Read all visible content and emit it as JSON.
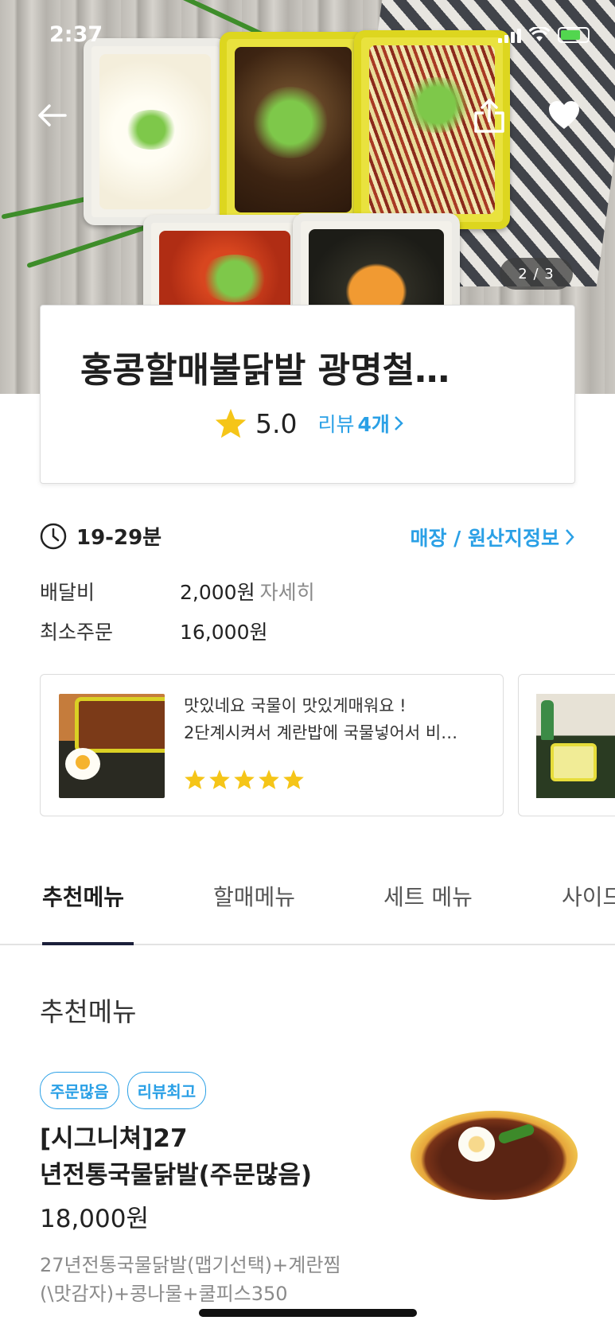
{
  "status_bar": {
    "time": "2:37"
  },
  "hero": {
    "image_counter": "2 / 3"
  },
  "store": {
    "name": "홍콩할매불닭발 광명철…",
    "rating": "5.0",
    "review_label": "리뷰",
    "review_count": "4개",
    "rating_stars": 5
  },
  "info": {
    "delivery_time": "19-29분",
    "origin_link": "매장 / 원산지정보",
    "delivery_fee_label": "배달비",
    "delivery_fee_value": "2,000원",
    "delivery_fee_detail": "자세히",
    "min_order_label": "최소주문",
    "min_order_value": "16,000원"
  },
  "reviews": [
    {
      "line1": "맛있네요 국물이 맛있게매워요 !",
      "line2": "2단계시켜서 계란밥에 국물넣어서 비…",
      "stars": 5
    }
  ],
  "tabs": [
    {
      "label": "추천메뉴",
      "active": true
    },
    {
      "label": "할매메뉴",
      "active": false
    },
    {
      "label": "세트 메뉴",
      "active": false
    },
    {
      "label": "사이드",
      "active": false
    }
  ],
  "menu_section": {
    "title": "추천메뉴",
    "items": [
      {
        "badges": [
          "주문많음",
          "리뷰최고"
        ],
        "name_line1": "[시그니쳐]27",
        "name_line2": "년전통국물닭발(주문많음)",
        "price": "18,000원",
        "desc_line1": "27년전통국물닭발(맵기선택)+계란찜",
        "desc_line2": "(\\맛감자)+콩나물+쿨피스350"
      }
    ]
  },
  "colors": {
    "accent": "#2aa0e6",
    "star": "#f5c518",
    "tab_underline": "#1b1f3a"
  }
}
